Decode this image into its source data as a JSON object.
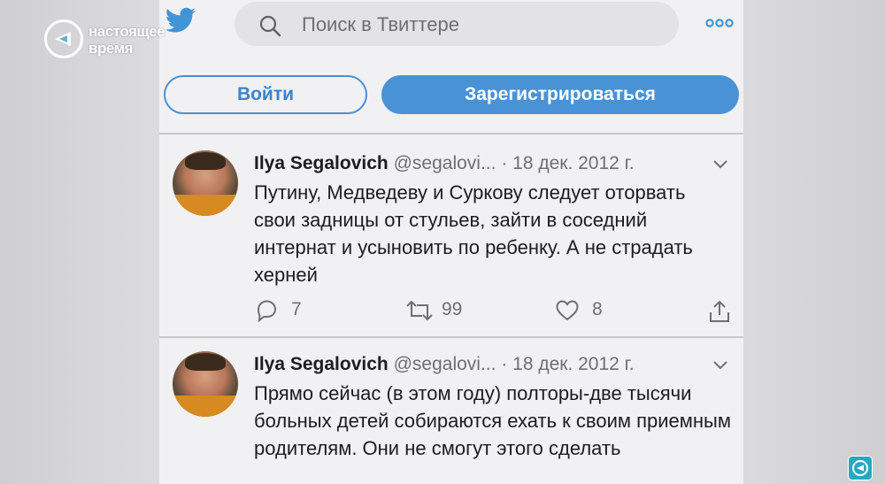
{
  "overlay": {
    "channel_logo_line1": "настоящее",
    "channel_logo_line2": "время"
  },
  "top_bar": {
    "search_placeholder": "Поиск в Твиттере",
    "more_icon": "more-dots-icon",
    "brand_icon": "twitter-bird-icon"
  },
  "auth": {
    "login_label": "Войти",
    "signup_label": "Зарегистрироваться"
  },
  "tweets": [
    {
      "name": "Ilya Segalovich",
      "handle": "@segalovi...",
      "date": "· 18 дек. 2012 г.",
      "text": "Путину, Медведеву и Суркову следует оторвать свои задницы от стульев, зайти в соседний интернат и усыновить по ребенку. А не страдать херней",
      "replies": "7",
      "retweets": "99",
      "likes": "8"
    },
    {
      "name": "Ilya Segalovich",
      "handle": "@segalovi...",
      "date": "· 18 дек. 2012 г.",
      "text": "Прямо сейчас (в этом году) полторы-две тысячи больных детей собираются ехать к своим приемным родителям. Они не смогут этого сделать"
    }
  ],
  "colors": {
    "accent": "#4a92d6",
    "screen_bg": "#f1f1f3",
    "text": "#1d1d1f",
    "muted": "#6e6e74"
  }
}
